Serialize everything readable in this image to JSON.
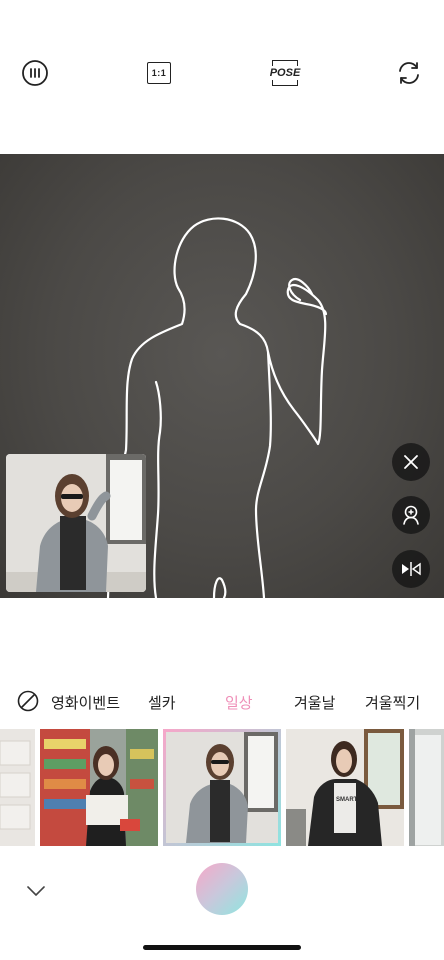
{
  "toolbar": {
    "menu_icon": "menu-dots-icon",
    "ratio_label": "1:1",
    "pose_label": "POSE",
    "flip_icon": "camera-switch-icon"
  },
  "camera": {
    "overlay": "pose-outline",
    "side_buttons": [
      "close-icon",
      "person-zoom-icon",
      "mirror-icon"
    ]
  },
  "categories": {
    "none_icon": "no-filter-icon",
    "items": [
      "영화이벤트",
      "셀카",
      "일상",
      "겨울날",
      "겨울찍기"
    ],
    "active": "일상",
    "active_color": "#ef8fb8"
  },
  "bottom": {
    "collapse_icon": "chevron-down-icon",
    "shutter_gradient": [
      "#f7a8c8",
      "#8fe6df"
    ]
  }
}
